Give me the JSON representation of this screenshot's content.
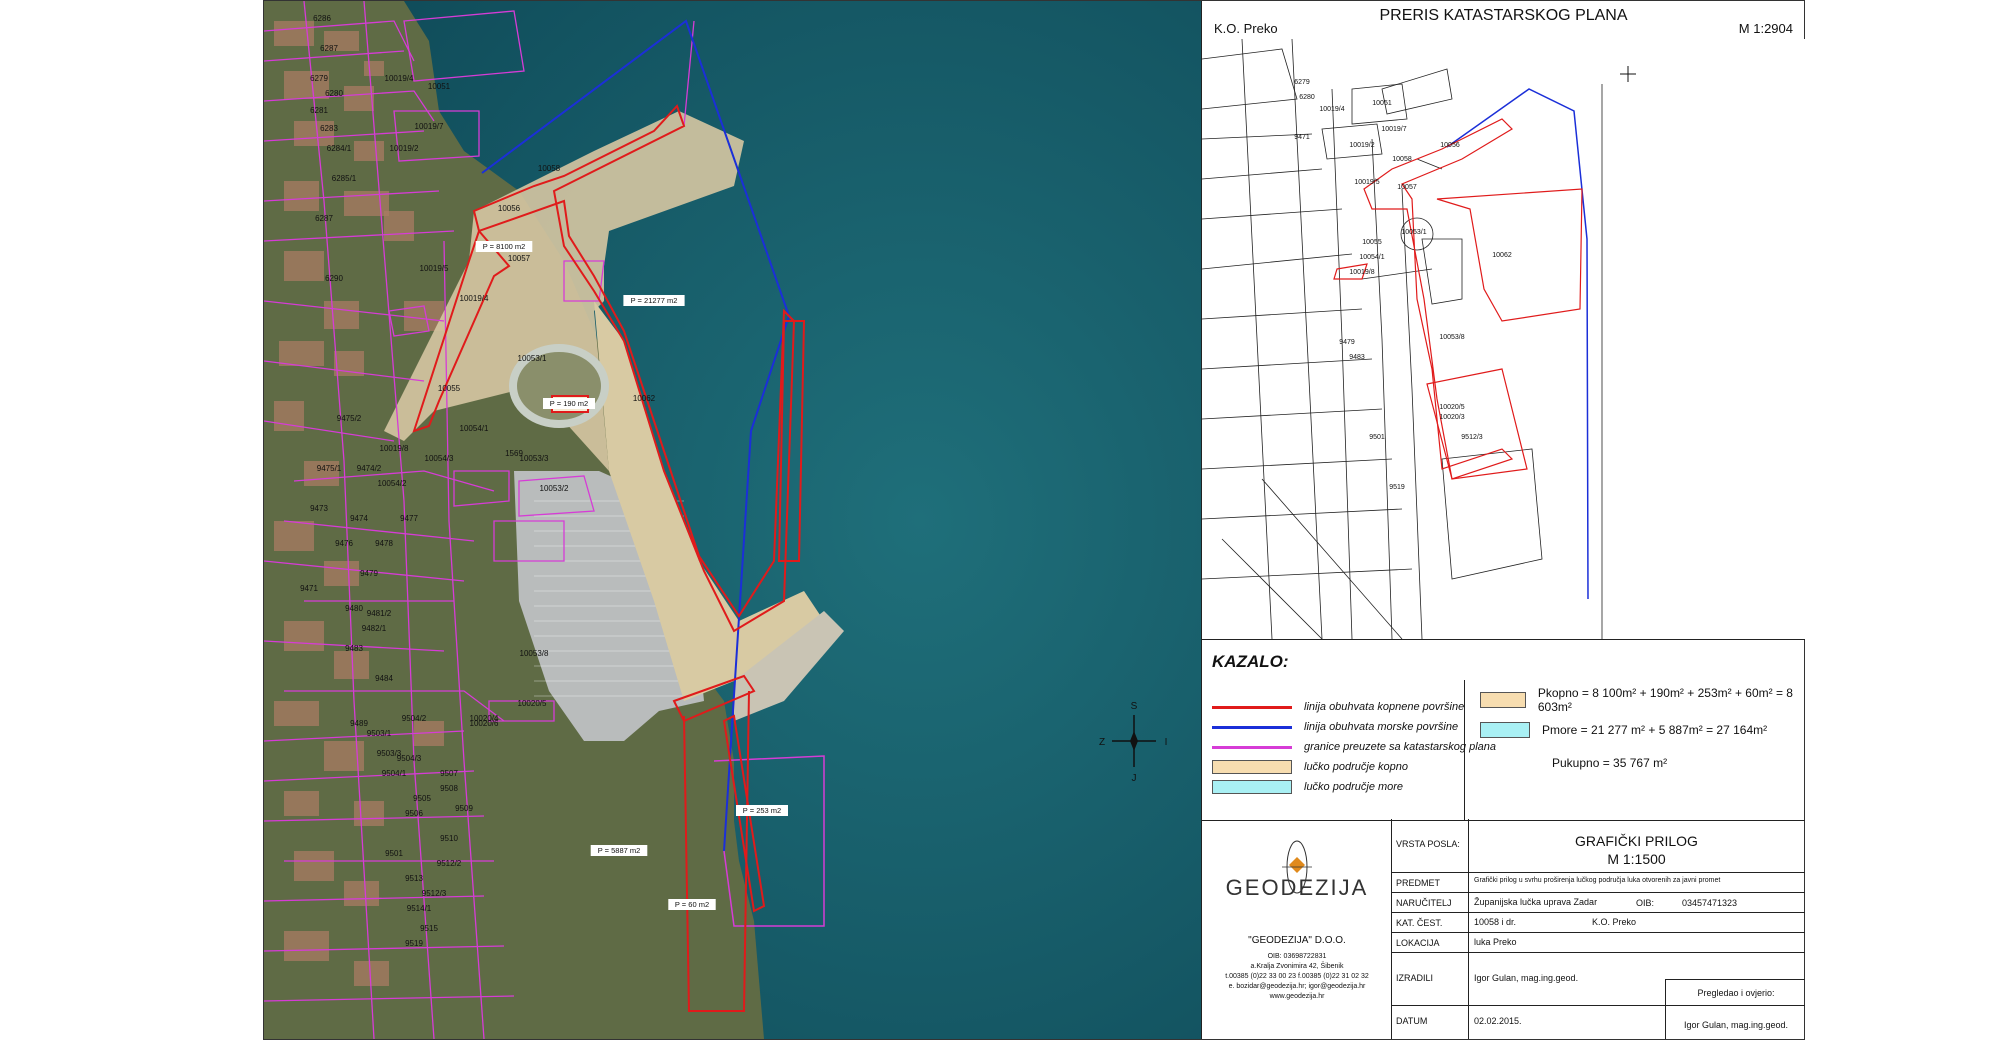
{
  "aerial": {
    "parcel_labels": [
      {
        "t": "6286"
      },
      {
        "t": "6287"
      },
      {
        "t": "6279"
      },
      {
        "t": "6280"
      },
      {
        "t": "6281"
      },
      {
        "t": "6283"
      },
      {
        "t": "6284/1"
      },
      {
        "t": "6285/1"
      },
      {
        "t": "6287"
      },
      {
        "t": "6290"
      },
      {
        "t": "10019/4"
      },
      {
        "t": "10051"
      },
      {
        "t": "10019/7"
      },
      {
        "t": "10019/2"
      },
      {
        "t": "10058"
      },
      {
        "t": "10056"
      },
      {
        "t": "10057"
      },
      {
        "t": "10019/5"
      },
      {
        "t": "10019/4"
      },
      {
        "t": "10053/1"
      },
      {
        "t": "10055"
      },
      {
        "t": "10054/1"
      },
      {
        "t": "10062"
      },
      {
        "t": "9475/2"
      },
      {
        "t": "10019/8"
      },
      {
        "t": "10054/3"
      },
      {
        "t": "1569"
      },
      {
        "t": "10053/3"
      },
      {
        "t": "10054/2"
      },
      {
        "t": "10053/2"
      },
      {
        "t": "9475/1"
      },
      {
        "t": "9474/2"
      },
      {
        "t": "9473"
      },
      {
        "t": "9474"
      },
      {
        "t": "9477"
      },
      {
        "t": "9476"
      },
      {
        "t": "9478"
      },
      {
        "t": "9479"
      },
      {
        "t": "9471"
      },
      {
        "t": "9480"
      },
      {
        "t": "9481/2"
      },
      {
        "t": "9482/1"
      },
      {
        "t": "9483"
      },
      {
        "t": "10053/8"
      },
      {
        "t": "9484"
      },
      {
        "t": "9489"
      },
      {
        "t": "9503/1"
      },
      {
        "t": "9504/2"
      },
      {
        "t": "10020/5"
      },
      {
        "t": "10020/6"
      },
      {
        "t": "9503/3"
      },
      {
        "t": "9504/3"
      },
      {
        "t": "9504/1"
      },
      {
        "t": "9507"
      },
      {
        "t": "9508"
      },
      {
        "t": "9505"
      },
      {
        "t": "9509"
      },
      {
        "t": "9506"
      },
      {
        "t": "9510"
      },
      {
        "t": "9501"
      },
      {
        "t": "9512/2"
      },
      {
        "t": "9513"
      },
      {
        "t": "9512/3"
      },
      {
        "t": "9514/1"
      },
      {
        "t": "9515"
      },
      {
        "t": "9519"
      },
      {
        "t": "10020/4"
      }
    ],
    "area_labels": [
      {
        "t": "P = 8100 m2"
      },
      {
        "t": "P = 21277 m2"
      },
      {
        "t": "P = 190 m2"
      },
      {
        "t": "P = 5887 m2"
      },
      {
        "t": "P = 253 m2"
      },
      {
        "t": "P = 60 m2"
      }
    ],
    "compass": {
      "n": "S",
      "s": "J",
      "w": "Z",
      "e": "I"
    }
  },
  "cadastral": {
    "ko": "K.O. Preko",
    "title": "PRERIS KATASTARSKOG PLANA",
    "scale": "M 1:2904",
    "labels": [
      {
        "t": "6279"
      },
      {
        "t": "6280"
      },
      {
        "t": "10019/4"
      },
      {
        "t": "10051"
      },
      {
        "t": "10019/7"
      },
      {
        "t": "10019/2"
      },
      {
        "t": "10058"
      },
      {
        "t": "10056"
      },
      {
        "t": "10057"
      },
      {
        "t": "10019/5"
      },
      {
        "t": "10053/1"
      },
      {
        "t": "10055"
      },
      {
        "t": "10062"
      },
      {
        "t": "10054/1"
      },
      {
        "t": "10019/8"
      },
      {
        "t": "10053/8"
      },
      {
        "t": "10020/5"
      },
      {
        "t": "10020/3"
      },
      {
        "t": "9512/3"
      },
      {
        "t": "9501"
      },
      {
        "t": "9519"
      },
      {
        "t": "9483"
      },
      {
        "t": "9479"
      },
      {
        "t": "9471"
      }
    ]
  },
  "legend": {
    "title": "KAZALO:",
    "items": [
      {
        "text": "linija obuhvata kopnene površine",
        "color": "#e01b1b",
        "kind": "line"
      },
      {
        "text": "linija obuhvata morske površine",
        "color": "#1b2fd8",
        "kind": "line"
      },
      {
        "text": "granice preuzete sa katastarskog plana",
        "color": "#d63cd6",
        "kind": "line"
      },
      {
        "text": "lučko područje kopno",
        "color": "#f7ddb0",
        "kind": "box"
      },
      {
        "text": "lučko područje more",
        "color": "#a9f0f4",
        "kind": "box"
      }
    ],
    "calc": {
      "land": "Pkopno = 8 100m² + 190m² + 253m² + 60m² = 8 603m²",
      "sea": "Pmore = 21 277 m² + 5 887m² = 27 164m²",
      "total": "Pukupno = 35 767 m²",
      "land_color": "#f7ddb0",
      "sea_color": "#a9f0f4"
    }
  },
  "company": {
    "name": "GEODEZIJA",
    "full_name": "\"GEODEZIJA\" D.O.O.",
    "oib": "OIB: 03698722831",
    "address": "a.Kralja Zvonimira 42, Šibenik",
    "phone": "t.00385 (0)22 33 00 23 f.00385 (0)22 31 02 32",
    "email": "e. bozidar@geodezija.hr; igor@geodezija.hr",
    "web": "www.geodezija.hr"
  },
  "titleblock": {
    "vrsta_key": "VRSTA POSLA:",
    "vrsta_val1": "GRAFIČKI PRILOG",
    "vrsta_val2": "M 1:1500",
    "predmet_key": "PREDMET",
    "predmet_val": "Grafički prilog u svrhu proširenja lučkog područja luka otvorenih za javni promet",
    "narucitelj_key": "NARUČITELJ",
    "narucitelj_val": "Županijska lučka uprava Zadar",
    "oib_key": "OIB:",
    "oib_val": "03457471323",
    "kat_key": "KAT. ČEST.",
    "kat_val": "10058 i dr.",
    "ko_val": "K.O. Preko",
    "lokacija_key": "LOKACIJA",
    "lokacija_val": "luka Preko",
    "izradili_key": "IZRADILI",
    "izradili_val": "Igor Gulan, mag.ing.geod.",
    "datum_key": "DATUM",
    "datum_val": "02.02.2015.",
    "pregledao_key": "Pregledao i ovjerio:",
    "pregledao_val": "Igor Gulan, mag.ing.geod."
  }
}
